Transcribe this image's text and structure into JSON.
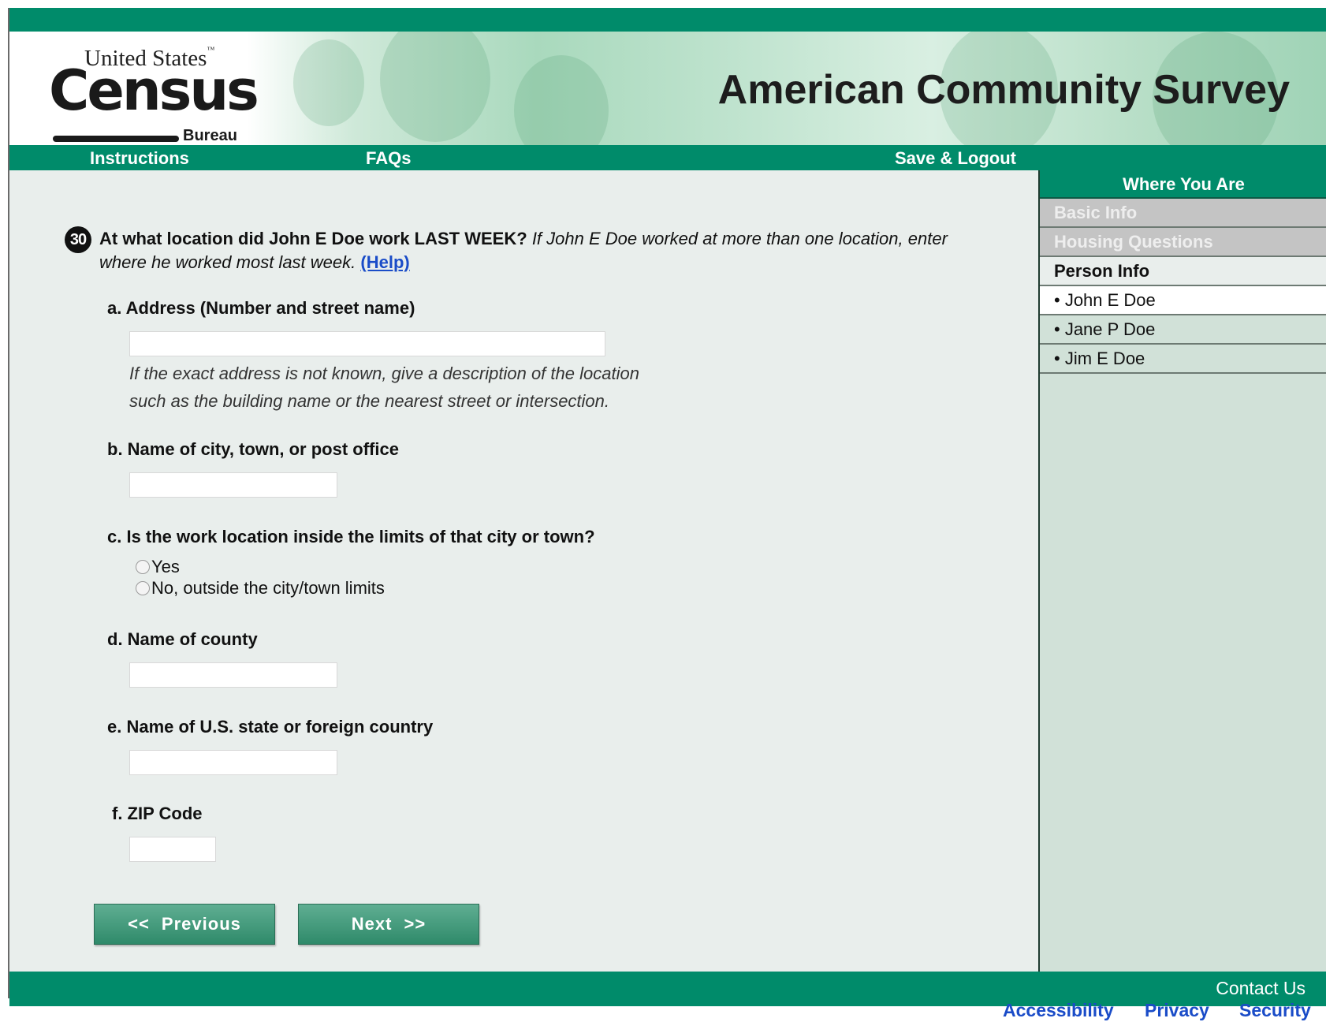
{
  "header": {
    "logo_line1": "United States",
    "logo_tm": "™",
    "logo_main": "Census",
    "logo_line3": "Bureau",
    "survey_title": "American Community Survey"
  },
  "nav": {
    "instructions": "Instructions",
    "faqs": "FAQs",
    "save_logout": "Save & Logout"
  },
  "sidebar": {
    "heading": "Where You Are",
    "items": [
      {
        "label": "Basic Info",
        "state": "disabled"
      },
      {
        "label": "Housing Questions",
        "state": "disabled"
      },
      {
        "label": "Person Info",
        "state": "section"
      },
      {
        "label": "• John E Doe",
        "state": "current"
      },
      {
        "label": "• Jane P Doe",
        "state": "person"
      },
      {
        "label": "• Jim E Doe",
        "state": "person"
      }
    ]
  },
  "question": {
    "number": "30",
    "main": "At what location did John E Doe work LAST WEEK?",
    "instruction": "If John E Doe worked at more than one location, enter where he worked most last week.",
    "help": "(Help)",
    "a_label": "a. Address (Number and street name)",
    "a_value": "",
    "a_hint_line1": "If the exact address is not known, give a description of the location",
    "a_hint_line2": "such as the building name or the nearest street or intersection.",
    "b_label": "b. Name of city, town, or post office",
    "b_value": "",
    "c_label": "c. Is the work location inside the limits of that city or town?",
    "c_option_yes": "Yes",
    "c_option_no": "No, outside the city/town limits",
    "d_label": "d. Name of county",
    "d_value": "",
    "e_label": "e. Name of U.S. state or foreign country",
    "e_value": "",
    "f_label": "f. ZIP Code",
    "f_value": ""
  },
  "buttons": {
    "previous": "<<  Previous",
    "next": "Next  >>"
  },
  "footer": {
    "contact": "Contact Us",
    "accessibility": "Accessibility",
    "privacy": "Privacy",
    "security": "Security"
  },
  "colors": {
    "brand_green": "#008b6a",
    "link_blue": "#1a4cc8"
  }
}
